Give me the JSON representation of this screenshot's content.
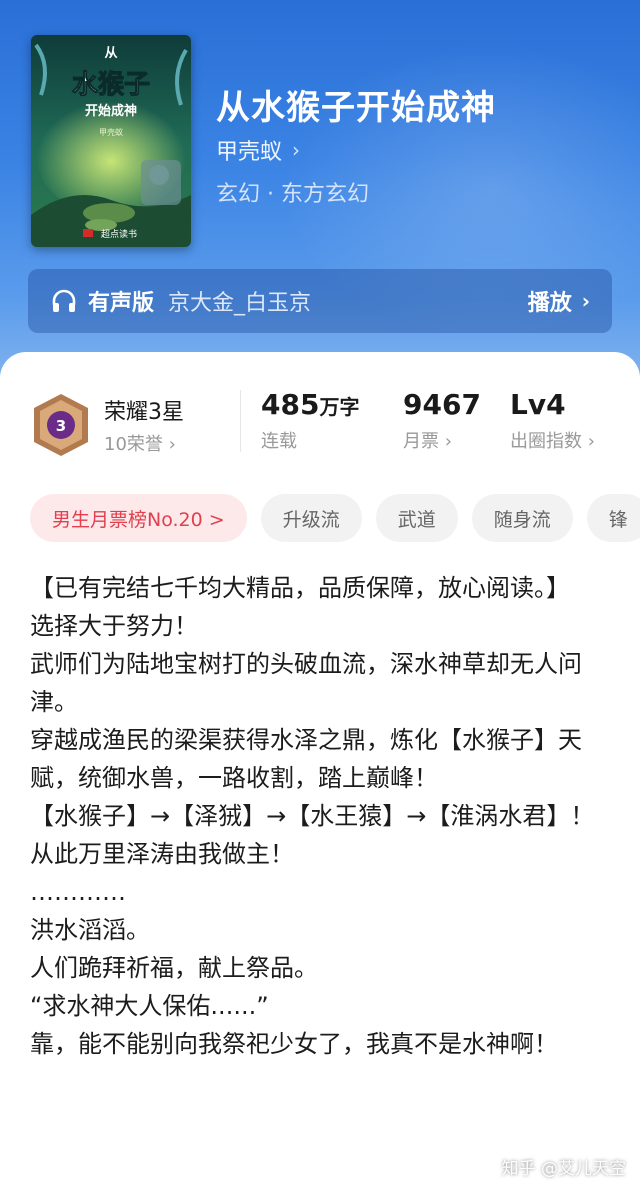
{
  "book": {
    "title": "从水猴子开始成神",
    "author": "甲壳蚁",
    "genre": "玄幻 · 东方玄幻",
    "cover": {
      "top_text": "从",
      "main_text": "水猴子",
      "sub_text": "开始成神",
      "author_text": "甲壳蚁",
      "publisher": "超点读书"
    }
  },
  "audio": {
    "label": "有声版",
    "narrator": "京大金_白玉京",
    "play": "播放"
  },
  "honor": {
    "level_number": "3",
    "title": "荣耀3星",
    "sub": "10荣誉"
  },
  "stats": {
    "words_value": "485",
    "words_unit": "万字",
    "words_label": "连载",
    "tickets_value": "9467",
    "tickets_label": "月票",
    "level_value": "Lv4",
    "level_label": "出圈指数"
  },
  "tags": [
    "男生月票榜No.20 >",
    "升级流",
    "武道",
    "随身流",
    "锋"
  ],
  "description": [
    "【已有完结七千均大精品，品质保障，放心阅读。】",
    "选择大于努力！",
    "武师们为陆地宝树打的头破血流，深水神草却无人问津。",
    "穿越成渔民的梁渠获得水泽之鼎，炼化【水猴子】天赋，统御水兽，一路收割，踏上巅峰！",
    "【水猴子】→【泽狨】→【水王猿】→【淮涡水君】！",
    "从此万里泽涛由我做主！",
    "…………",
    "洪水滔滔。",
    "人们跪拜祈福，献上祭品。",
    "“求水神大人保佑......”",
    "靠，能不能别向我祭祀少女了，我真不是水神啊！"
  ],
  "watermark": "知乎 @艾儿天空",
  "colors": {
    "accent_blue": "#2f78dd",
    "rank_red": "#e0404f"
  }
}
